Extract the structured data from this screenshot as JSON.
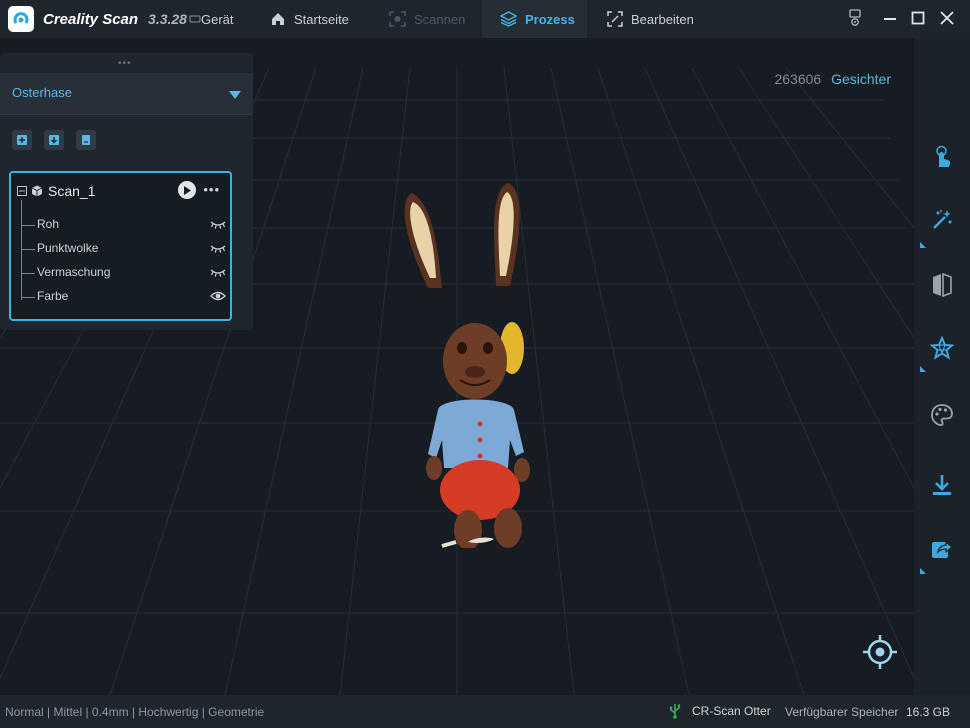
{
  "app": {
    "name": "Creality Scan",
    "version": "3.3.28"
  },
  "topbar": {
    "menu": {
      "device": "Gerät",
      "home": "Startseite",
      "scan": "Scannen",
      "process": "Prozess",
      "edit": "Bearbeiten"
    },
    "active_tab": "Prozess"
  },
  "viewport": {
    "face_count": "263606",
    "face_label": "Gesichter"
  },
  "left_panel": {
    "project_name": "Osterhase",
    "scan": {
      "name": "Scan_1",
      "layers": [
        {
          "label": "Roh",
          "visibility_icon": "eye-closed-icon"
        },
        {
          "label": "Punktwolke",
          "visibility_icon": "eye-closed-icon"
        },
        {
          "label": "Vermaschung",
          "visibility_icon": "eye-closed-icon"
        },
        {
          "label": "Farbe",
          "visibility_icon": "eye-open-icon"
        }
      ]
    }
  },
  "right_toolbar": [
    "touch-select-icon",
    "magic-wand-icon",
    "mirror-icon",
    "star-fill-icon",
    "palette-icon",
    "download-icon",
    "share-icon"
  ],
  "statusbar": {
    "settings": "Normal | Mittel | 0.4mm | Hochwertig | Geometrie",
    "device": "CR-Scan Otter",
    "memory_label": "Verfügbarer Speicher",
    "memory_value": "16.3 GB"
  },
  "colors": {
    "accent": "#3fb6e8",
    "background": "#161c22",
    "panel": "#1f272e"
  }
}
